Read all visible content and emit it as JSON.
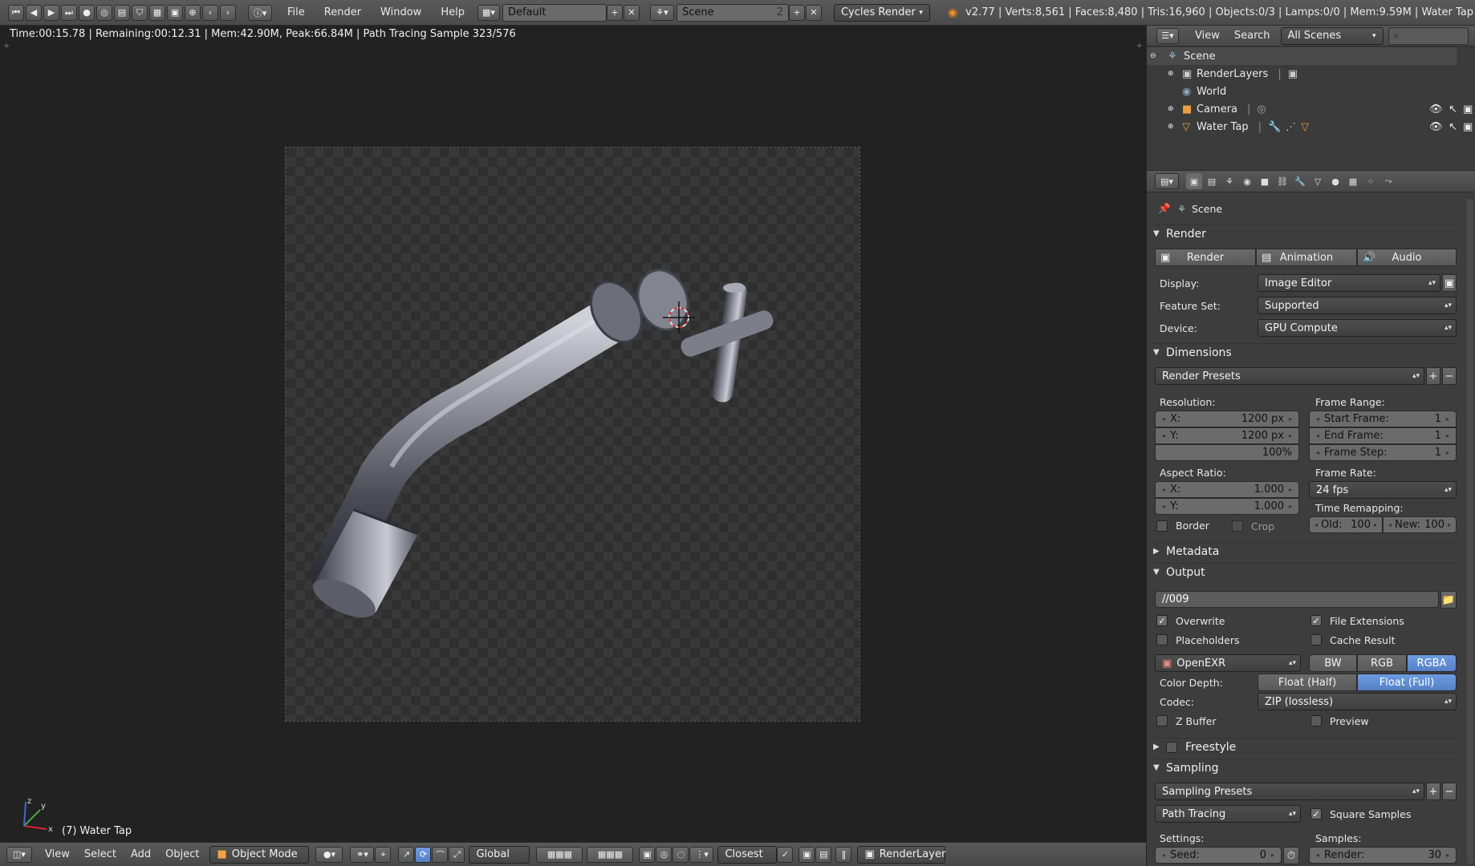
{
  "top_bar": {
    "menus": [
      "File",
      "Render",
      "Window",
      "Help"
    ],
    "layout_name": "Default",
    "scene_name": "Scene",
    "scene_users": "2",
    "engine": "Cycles Render",
    "stats": "v2.77 | Verts:8,561 | Faces:8,480 | Tris:16,960 | Objects:0/3 | Lamps:0/0 | Mem:9.59M | Water Tap"
  },
  "viewport": {
    "render_status": "Time:00:15.78 | Remaining:00:12.31 | Mem:42.90M, Peak:66.84M | Path Tracing Sample 323/576",
    "object_label": "(7) Water Tap",
    "axis_labels": {
      "x": "x",
      "y": "y",
      "z": "z"
    }
  },
  "bottom_bar": {
    "menus": [
      "View",
      "Select",
      "Add",
      "Object"
    ],
    "mode": "Object Mode",
    "orientation": "Global",
    "snap": "Closest",
    "render_layer": "RenderLayer"
  },
  "outliner": {
    "menus": [
      "View",
      "Search"
    ],
    "display_mode": "All Scenes",
    "items": [
      {
        "label": "Scene",
        "icon": "scene-icon"
      },
      {
        "label": "RenderLayers",
        "icon": "renderlayers-icon"
      },
      {
        "label": "World",
        "icon": "world-icon"
      },
      {
        "label": "Camera",
        "icon": "camera-icon"
      },
      {
        "label": "Water Tap",
        "icon": "mesh-icon"
      }
    ]
  },
  "properties": {
    "context_path": "Scene",
    "render_panel": {
      "title": "Render",
      "buttons": [
        "Render",
        "Animation",
        "Audio"
      ],
      "display_label": "Display:",
      "display_value": "Image Editor",
      "feature_label": "Feature Set:",
      "feature_value": "Supported",
      "device_label": "Device:",
      "device_value": "GPU Compute"
    },
    "dimensions_panel": {
      "title": "Dimensions",
      "presets": "Render Presets",
      "resolution_label": "Resolution:",
      "res_x_label": "X:",
      "res_x": "1200 px",
      "res_y_label": "Y:",
      "res_y": "1200 px",
      "res_pct": "100%",
      "frame_range_label": "Frame Range:",
      "start_label": "Start Frame:",
      "start": "1",
      "end_label": "End Frame:",
      "end": "1",
      "step_label": "Frame Step:",
      "step": "1",
      "aspect_label": "Aspect Ratio:",
      "aspect_x_label": "X:",
      "aspect_x": "1.000",
      "aspect_y_label": "Y:",
      "aspect_y": "1.000",
      "frame_rate_label": "Frame Rate:",
      "frame_rate": "24 fps",
      "time_remap_label": "Time Remapping:",
      "old_label": "Old:",
      "old": "100",
      "new_label": "New:",
      "new": "100",
      "border_label": "Border",
      "crop_label": "Crop"
    },
    "metadata_panel": {
      "title": "Metadata"
    },
    "output_panel": {
      "title": "Output",
      "path": "//009",
      "overwrite": "Overwrite",
      "file_ext": "File Extensions",
      "placeholders": "Placeholders",
      "cache": "Cache Result",
      "format": "OpenEXR",
      "channels": [
        "BW",
        "RGB",
        "RGBA"
      ],
      "color_depth_label": "Color Depth:",
      "depths": [
        "Float (Half)",
        "Float (Full)"
      ],
      "codec_label": "Codec:",
      "codec": "ZIP (lossless)",
      "zbuffer": "Z Buffer",
      "preview": "Preview"
    },
    "freestyle_panel": {
      "title": "Freestyle"
    },
    "sampling_panel": {
      "title": "Sampling",
      "presets": "Sampling Presets",
      "integrator": "Path Tracing",
      "square": "Square Samples",
      "settings_label": "Settings:",
      "samples_label": "Samples:",
      "seed_label": "Seed:",
      "seed": "0",
      "render_label": "Render:",
      "render": "30"
    }
  },
  "colors": {
    "accent": "#5680c6",
    "background": "#3d3d3d",
    "viewport": "#222222"
  }
}
